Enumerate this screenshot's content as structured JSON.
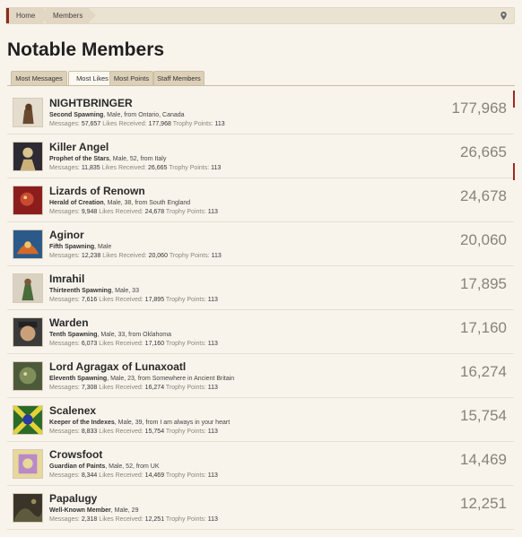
{
  "breadcrumb": {
    "home": "Home",
    "members": "Members"
  },
  "page_title": "Notable Members",
  "tabs": [
    "Most Messages",
    "Most Likes",
    "Most Points",
    "Staff Members"
  ],
  "active_tab": "Most Likes",
  "stat_labels": {
    "messages": "Messages:",
    "likes": "Likes Received:",
    "trophy": "Trophy Points:"
  },
  "members": [
    {
      "name": "NIGHTBRINGER",
      "title": "Second Spawning",
      "details": ", Male, from Ontario, Canada",
      "messages": "57,657",
      "likes": "177,968",
      "trophy": "113",
      "count": "177,968"
    },
    {
      "name": "Killer Angel",
      "title": "Prophet of the Stars",
      "details": ", Male, 52, from Italy",
      "messages": "11,835",
      "likes": "26,665",
      "trophy": "113",
      "count": "26,665"
    },
    {
      "name": "Lizards of Renown",
      "title": "Herald of Creation",
      "details": ", Male, 38, from South England",
      "messages": "9,948",
      "likes": "24,678",
      "trophy": "113",
      "count": "24,678"
    },
    {
      "name": "Aginor",
      "title": "Fifth Spawning",
      "details": ", Male",
      "messages": "12,238",
      "likes": "20,060",
      "trophy": "113",
      "count": "20,060"
    },
    {
      "name": "Imrahil",
      "title": "Thirteenth Spawning",
      "details": ", Male, 33",
      "messages": "7,616",
      "likes": "17,895",
      "trophy": "113",
      "count": "17,895"
    },
    {
      "name": "Warden",
      "title": "Tenth Spawning",
      "details": ", Male, 33, from Oklahoma",
      "messages": "6,073",
      "likes": "17,160",
      "trophy": "113",
      "count": "17,160"
    },
    {
      "name": "Lord Agragax of Lunaxoatl",
      "title": "Eleventh Spawning",
      "details": ", Male, 23, from Somewhere in Ancient Britain",
      "messages": "7,308",
      "likes": "16,274",
      "trophy": "113",
      "count": "16,274"
    },
    {
      "name": "Scalenex",
      "title": "Keeper of the Indexes",
      "details": ", Male, 39, from I am always in your heart",
      "messages": "8,833",
      "likes": "15,754",
      "trophy": "113",
      "count": "15,754"
    },
    {
      "name": "Crowsfoot",
      "title": "Guardian of Paints",
      "details": ", Male, 52, from UK",
      "messages": "8,344",
      "likes": "14,469",
      "trophy": "113",
      "count": "14,469"
    },
    {
      "name": "Papalugy",
      "title": "Well-Known Member",
      "details": ", Male, 29",
      "messages": "2,318",
      "likes": "12,251",
      "trophy": "113",
      "count": "12,251"
    }
  ],
  "colors": {
    "accent": "#8b2a1e",
    "background": "#f8f4ec",
    "tab": "#dcd0b8"
  },
  "icons": {
    "location": "map-pin-icon"
  }
}
